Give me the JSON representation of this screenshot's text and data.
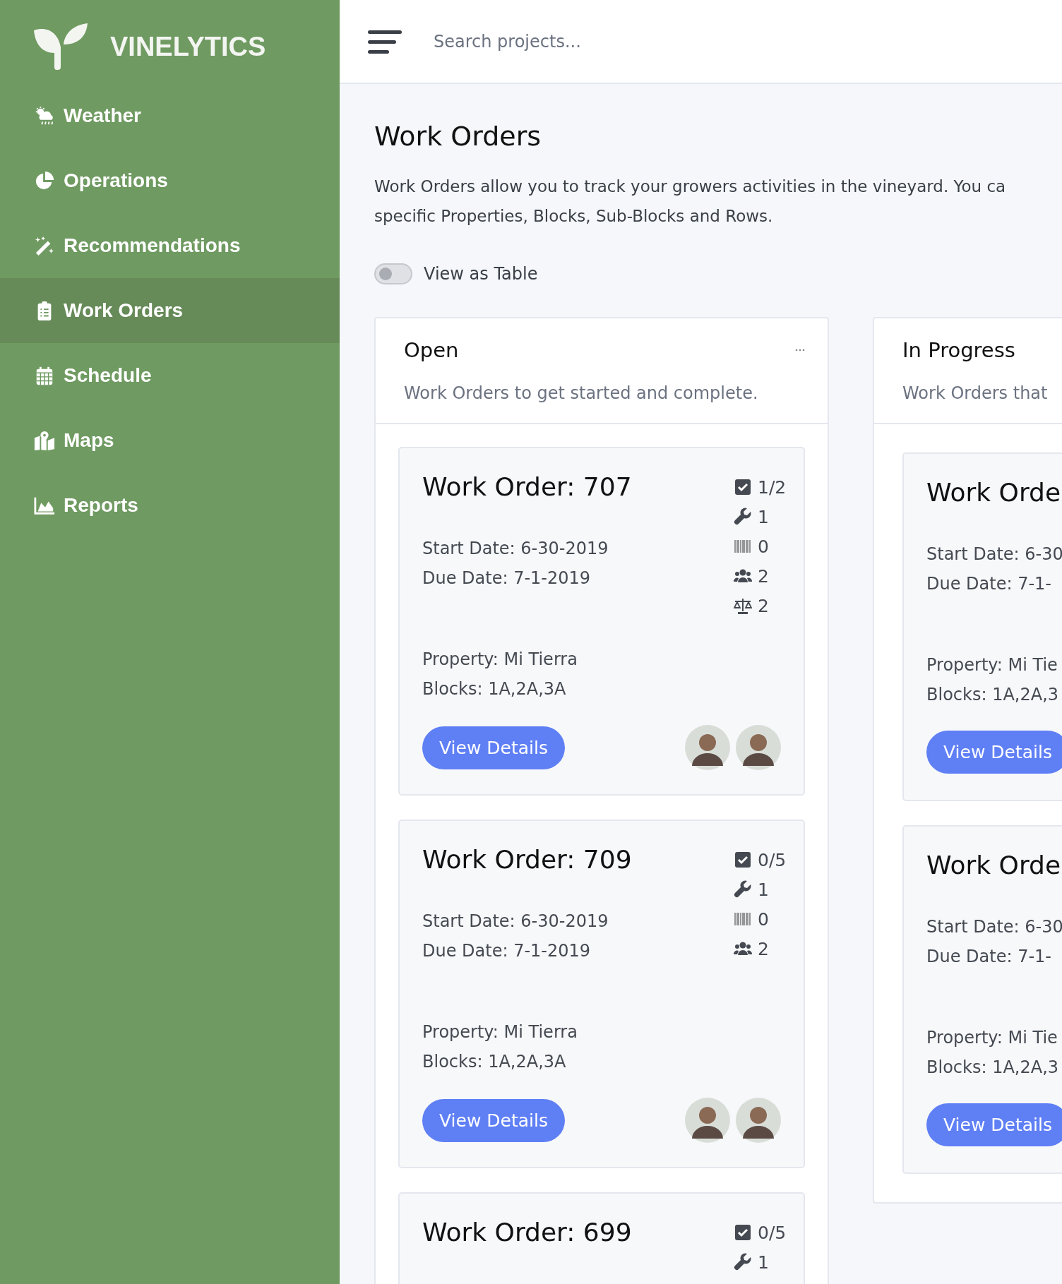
{
  "brand": "VINELYTICS",
  "sidebar": {
    "items": [
      {
        "label": "Weather",
        "kind": "weather",
        "selected": false
      },
      {
        "label": "Operations",
        "kind": "pie",
        "selected": false
      },
      {
        "label": "Recommendations",
        "kind": "wand",
        "selected": false
      },
      {
        "label": "Work Orders",
        "kind": "clipboard",
        "selected": true
      },
      {
        "label": "Schedule",
        "kind": "calendar",
        "selected": false
      },
      {
        "label": "Maps",
        "kind": "map",
        "selected": false
      },
      {
        "label": "Reports",
        "kind": "chart",
        "selected": false
      }
    ]
  },
  "search": {
    "placeholder": "Search projects..."
  },
  "page": {
    "title": "Work Orders",
    "description": [
      "Work Orders allow you to track your growers activities in the vineyard. You ca",
      "specific Properties, Blocks, Sub-Blocks and Rows."
    ]
  },
  "view_toggle": {
    "label": "View as Table",
    "on": false
  },
  "columns": [
    {
      "title": "Open",
      "subtitle": "Work Orders to get started and complete.",
      "menu": true,
      "cards": [
        {
          "title": "Work Order: 707",
          "start": "Start Date: 6-30-2019",
          "due": "Due Date: 7-1-2019",
          "property": "Property: Mi Tierra",
          "blocks": "Blocks: 1A,2A,3A",
          "button": "View Details",
          "stats": [
            {
              "kind": "tasks",
              "value": "1/2"
            },
            {
              "kind": "tools",
              "value": "1"
            },
            {
              "kind": "barcode",
              "value": "0"
            },
            {
              "kind": "people",
              "value": "2"
            },
            {
              "kind": "scale",
              "value": "2"
            }
          ],
          "avatars": [
            {
              "kind": "picture"
            },
            {
              "kind": "picture"
            }
          ]
        },
        {
          "title": "Work Order: 709",
          "start": "Start Date: 6-30-2019",
          "due": "Due Date: 7-1-2019",
          "property": "Property: Mi Tierra",
          "blocks": "Blocks: 1A,2A,3A",
          "button": "View Details",
          "stats": [
            {
              "kind": "tasks",
              "value": "0/5"
            },
            {
              "kind": "tools",
              "value": "1"
            },
            {
              "kind": "barcode",
              "value": "0"
            },
            {
              "kind": "people",
              "value": "2"
            }
          ],
          "avatars": [
            {
              "kind": "picture"
            },
            {
              "kind": "picture"
            }
          ]
        },
        {
          "title": "Work Order: 699",
          "stats": [
            {
              "kind": "tasks",
              "value": "0/5"
            },
            {
              "kind": "tools",
              "value": "1"
            }
          ]
        }
      ]
    },
    {
      "title": "In Progress",
      "subtitle": "Work Orders that",
      "menu": false,
      "cards": [
        {
          "title": "Work Orde",
          "start": "Start Date: 6-30",
          "due": "Due Date: 7-1-",
          "property": "Property: Mi Tie",
          "blocks": "Blocks: 1A,2A,3",
          "button": "View Details"
        },
        {
          "title": "Work Orde",
          "start": "Start Date: 6-30",
          "due": "Due Date: 7-1-",
          "property": "Property: Mi Tie",
          "blocks": "Blocks: 1A,2A,3",
          "button": "View Details"
        }
      ]
    }
  ]
}
